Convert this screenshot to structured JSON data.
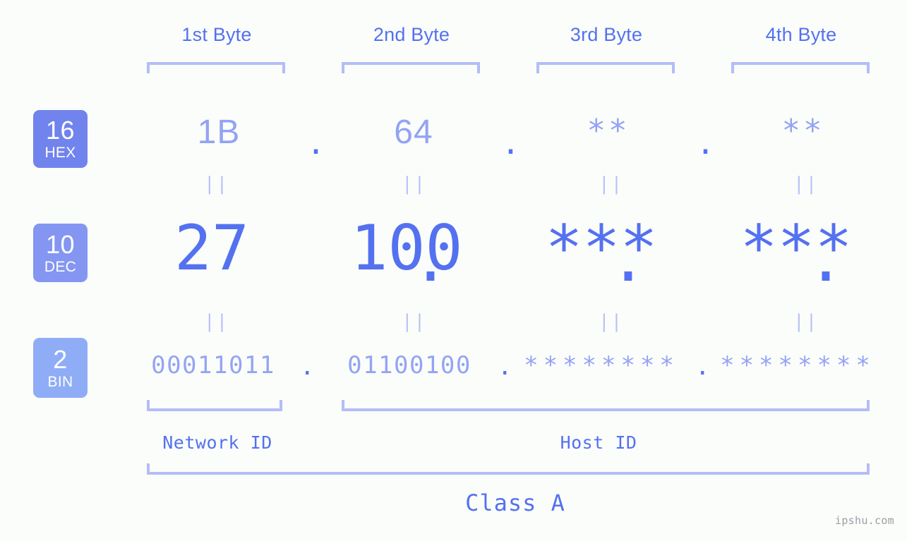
{
  "background_color": "#fbfdfa",
  "accent_color": "#5471f0",
  "muted_color": "#93a3f4",
  "bracket_color": "#b3bdf8",
  "watermark": "ipshu.com",
  "header": {
    "byte_labels": [
      "1st Byte",
      "2nd Byte",
      "3rd Byte",
      "4th Byte"
    ]
  },
  "radix_badges": [
    {
      "number": "16",
      "name": "HEX",
      "color": "#7183ec"
    },
    {
      "number": "10",
      "name": "DEC",
      "color": "#8496f2"
    },
    {
      "number": "2",
      "name": "BIN",
      "color": "#8facf7"
    }
  ],
  "rows": {
    "hex": {
      "radix": "16",
      "values": [
        "1B",
        "64",
        "**",
        "**"
      ],
      "separators": [
        ".",
        ".",
        "."
      ]
    },
    "dec": {
      "radix": "10",
      "values": [
        "27",
        "100",
        "***",
        "***"
      ],
      "separators": [
        ".",
        ".",
        "."
      ]
    },
    "bin": {
      "radix": "2",
      "values": [
        "00011011",
        "01100100",
        "********",
        "********"
      ],
      "separators": [
        ".",
        ".",
        "."
      ]
    }
  },
  "equals_connector": "||",
  "footer": {
    "network_id_label": "Network ID",
    "host_id_label": "Host ID",
    "class_label": "Class A"
  }
}
